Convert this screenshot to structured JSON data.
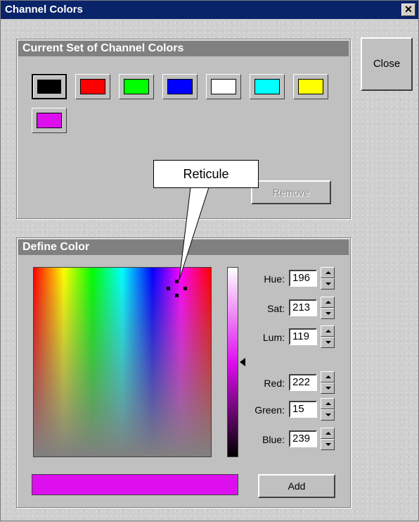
{
  "window": {
    "title": "Channel Colors",
    "close_glyph": "✕"
  },
  "current_set": {
    "header": "Current Set of Channel Colors",
    "swatches": [
      {
        "name": "black",
        "color": "#000000",
        "selected": true
      },
      {
        "name": "red",
        "color": "#ff0000"
      },
      {
        "name": "green",
        "color": "#00ff00"
      },
      {
        "name": "blue",
        "color": "#0000ff"
      },
      {
        "name": "white",
        "color": "#ffffff"
      },
      {
        "name": "cyan",
        "color": "#00ffff"
      },
      {
        "name": "yellow",
        "color": "#ffff00"
      },
      {
        "name": "magenta",
        "color": "#de0fef"
      }
    ],
    "remove_label": "Remove"
  },
  "close_button_label": "Close",
  "callout_text": "Reticule",
  "define_color": {
    "header": "Define Color",
    "fields": {
      "hue": {
        "label": "Hue:",
        "value": "196"
      },
      "sat": {
        "label": "Sat:",
        "value": "213"
      },
      "lum": {
        "label": "Lum:",
        "value": "119"
      },
      "red": {
        "label": "Red:",
        "value": "222"
      },
      "green": {
        "label": "Green:",
        "value": "15"
      },
      "blue": {
        "label": "Blue:",
        "value": "239"
      }
    },
    "preview_color": "#de0fef",
    "add_label": "Add"
  }
}
